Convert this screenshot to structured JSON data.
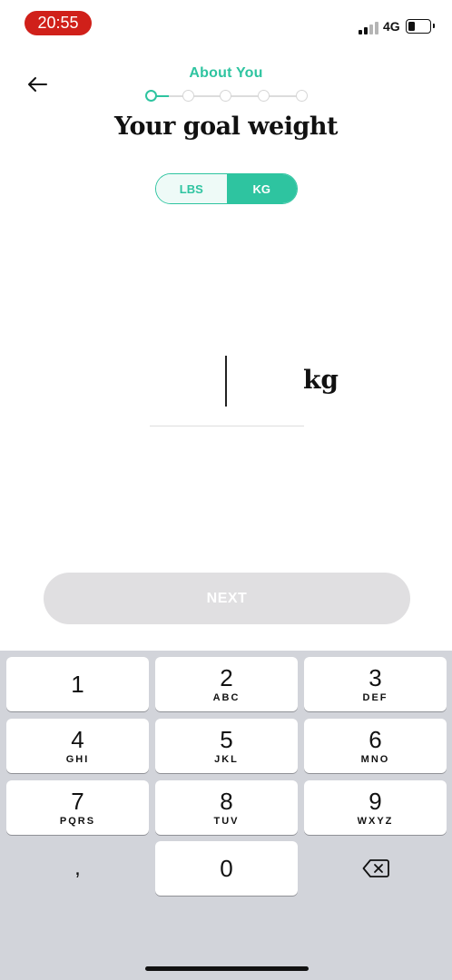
{
  "status_bar": {
    "time": "20:55",
    "network": "4G",
    "battery_fill_fraction": 0.35,
    "signal_bars_filled": 2,
    "signal_bars_total": 4
  },
  "header": {
    "step_label": "About You",
    "current_step": 1,
    "total_steps": 5,
    "title": "Your goal weight"
  },
  "unit_toggle": {
    "options": [
      {
        "label": "LBS",
        "selected": false
      },
      {
        "label": "KG",
        "selected": true
      }
    ]
  },
  "weight_input": {
    "value": "",
    "unit_suffix": "kg"
  },
  "next_button": {
    "label": "NEXT",
    "enabled": false
  },
  "keypad": {
    "keys": [
      {
        "digit": "1",
        "letters": ""
      },
      {
        "digit": "2",
        "letters": "ABC"
      },
      {
        "digit": "3",
        "letters": "DEF"
      },
      {
        "digit": "4",
        "letters": "GHI"
      },
      {
        "digit": "5",
        "letters": "JKL"
      },
      {
        "digit": "6",
        "letters": "MNO"
      },
      {
        "digit": "7",
        "letters": "PQRS"
      },
      {
        "digit": "8",
        "letters": "TUV"
      },
      {
        "digit": "9",
        "letters": "WXYZ"
      },
      {
        "digit": ",",
        "letters": ""
      },
      {
        "digit": "0",
        "letters": ""
      },
      {
        "digit": "",
        "letters": "",
        "icon": "backspace-icon"
      }
    ]
  },
  "colors": {
    "accent": "#2ec4a0",
    "time_pill": "#d0201a",
    "next_disabled": "#e0dfe1",
    "keypad_bg": "#d2d4da"
  }
}
